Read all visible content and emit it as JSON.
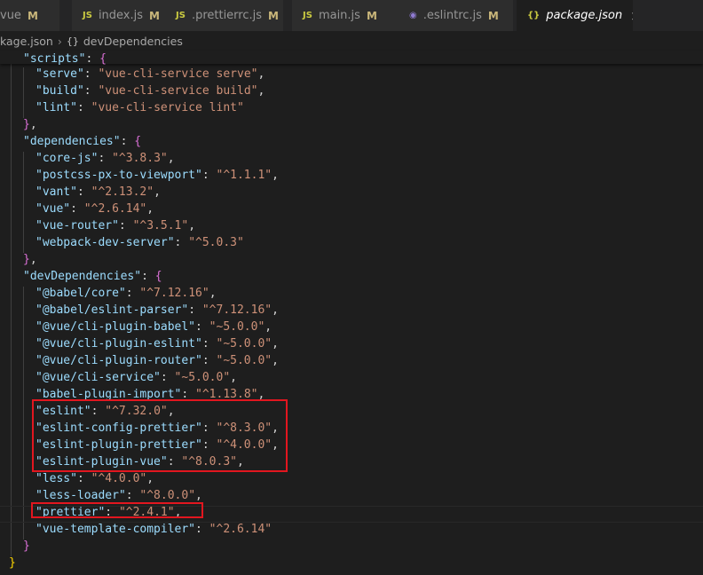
{
  "tabs": [
    {
      "name": "vue",
      "icon": "vue-icon",
      "label": "vue",
      "mod": "M"
    },
    {
      "name": "index-js",
      "icon": "js-icon",
      "icon_text": "JS",
      "label": "index.js",
      "mod": "M"
    },
    {
      "name": "prettierrc-js",
      "icon": "js-icon",
      "icon_text": "JS",
      "label": ".prettierrc.js",
      "mod": "M"
    },
    {
      "name": "main-js",
      "icon": "js-icon",
      "icon_text": "JS",
      "label": "main.js",
      "mod": "M"
    },
    {
      "name": "eslintrc-js",
      "icon": "eslint-icon",
      "icon_text": "◉",
      "label": ".eslintrc.js",
      "mod": "M"
    },
    {
      "name": "package-json",
      "icon": "braces-icon",
      "icon_text": "{}",
      "label": "package.json",
      "close": "×"
    }
  ],
  "breadcrumb": {
    "file": "kage.json",
    "separator": "›",
    "symbol_icon": "{}",
    "symbol": "devDependencies"
  },
  "code": {
    "lines": [
      [
        [
          "k",
          "\"scripts\""
        ],
        [
          "p",
          ": "
        ],
        [
          "b2",
          "{"
        ]
      ],
      [
        [
          "k",
          "\"serve\""
        ],
        [
          "p",
          ": "
        ],
        [
          "s",
          "\"vue-cli-service serve\""
        ],
        [
          "p",
          ","
        ]
      ],
      [
        [
          "k",
          "\"build\""
        ],
        [
          "p",
          ": "
        ],
        [
          "s",
          "\"vue-cli-service build\""
        ],
        [
          "p",
          ","
        ]
      ],
      [
        [
          "k",
          "\"lint\""
        ],
        [
          "p",
          ": "
        ],
        [
          "s",
          "\"vue-cli-service lint\""
        ]
      ],
      [
        [
          "b2",
          "}"
        ],
        [
          "p",
          ","
        ]
      ],
      [
        [
          "k",
          "\"dependencies\""
        ],
        [
          "p",
          ": "
        ],
        [
          "b2",
          "{"
        ]
      ],
      [
        [
          "k",
          "\"core-js\""
        ],
        [
          "p",
          ": "
        ],
        [
          "s",
          "\"^3.8.3\""
        ],
        [
          "p",
          ","
        ]
      ],
      [
        [
          "k",
          "\"postcss-px-to-viewport\""
        ],
        [
          "p",
          ": "
        ],
        [
          "s",
          "\"^1.1.1\""
        ],
        [
          "p",
          ","
        ]
      ],
      [
        [
          "k",
          "\"vant\""
        ],
        [
          "p",
          ": "
        ],
        [
          "s",
          "\"^2.13.2\""
        ],
        [
          "p",
          ","
        ]
      ],
      [
        [
          "k",
          "\"vue\""
        ],
        [
          "p",
          ": "
        ],
        [
          "s",
          "\"^2.6.14\""
        ],
        [
          "p",
          ","
        ]
      ],
      [
        [
          "k",
          "\"vue-router\""
        ],
        [
          "p",
          ": "
        ],
        [
          "s",
          "\"^3.5.1\""
        ],
        [
          "p",
          ","
        ]
      ],
      [
        [
          "k",
          "\"webpack-dev-server\""
        ],
        [
          "p",
          ": "
        ],
        [
          "s",
          "\"^5.0.3\""
        ]
      ],
      [
        [
          "b2",
          "}"
        ],
        [
          "p",
          ","
        ]
      ],
      [
        [
          "k",
          "\"devDependencies\""
        ],
        [
          "p",
          ": "
        ],
        [
          "b2",
          "{"
        ]
      ],
      [
        [
          "k",
          "\"@babel/core\""
        ],
        [
          "p",
          ": "
        ],
        [
          "s",
          "\"^7.12.16\""
        ],
        [
          "p",
          ","
        ]
      ],
      [
        [
          "k",
          "\"@babel/eslint-parser\""
        ],
        [
          "p",
          ": "
        ],
        [
          "s",
          "\"^7.12.16\""
        ],
        [
          "p",
          ","
        ]
      ],
      [
        [
          "k",
          "\"@vue/cli-plugin-babel\""
        ],
        [
          "p",
          ": "
        ],
        [
          "s",
          "\"~5.0.0\""
        ],
        [
          "p",
          ","
        ]
      ],
      [
        [
          "k",
          "\"@vue/cli-plugin-eslint\""
        ],
        [
          "p",
          ": "
        ],
        [
          "s",
          "\"~5.0.0\""
        ],
        [
          "p",
          ","
        ]
      ],
      [
        [
          "k",
          "\"@vue/cli-plugin-router\""
        ],
        [
          "p",
          ": "
        ],
        [
          "s",
          "\"~5.0.0\""
        ],
        [
          "p",
          ","
        ]
      ],
      [
        [
          "k",
          "\"@vue/cli-service\""
        ],
        [
          "p",
          ": "
        ],
        [
          "s",
          "\"~5.0.0\""
        ],
        [
          "p",
          ","
        ]
      ],
      [
        [
          "k",
          "\"babel-plugin-import\""
        ],
        [
          "p",
          ": "
        ],
        [
          "s",
          "\"^1.13.8\""
        ],
        [
          "p",
          ","
        ]
      ],
      [
        [
          "k",
          "\"eslint\""
        ],
        [
          "p",
          ": "
        ],
        [
          "s",
          "\"^7.32.0\""
        ],
        [
          "p",
          ","
        ]
      ],
      [
        [
          "k",
          "\"eslint-config-prettier\""
        ],
        [
          "p",
          ": "
        ],
        [
          "s",
          "\"^8.3.0\""
        ],
        [
          "p",
          ","
        ]
      ],
      [
        [
          "k",
          "\"eslint-plugin-prettier\""
        ],
        [
          "p",
          ": "
        ],
        [
          "s",
          "\"^4.0.0\""
        ],
        [
          "p",
          ","
        ]
      ],
      [
        [
          "k",
          "\"eslint-plugin-vue\""
        ],
        [
          "p",
          ": "
        ],
        [
          "s",
          "\"^8.0.3\""
        ],
        [
          "p",
          ","
        ]
      ],
      [
        [
          "k",
          "\"less\""
        ],
        [
          "p",
          ": "
        ],
        [
          "s",
          "\"^4.0.0\""
        ],
        [
          "p",
          ","
        ]
      ],
      [
        [
          "k",
          "\"less-loader\""
        ],
        [
          "p",
          ": "
        ],
        [
          "s",
          "\"^8.0.0\""
        ],
        [
          "p",
          ","
        ]
      ],
      [
        [
          "k",
          "\"prettier\""
        ],
        [
          "p",
          ": "
        ],
        [
          "s",
          "\"^2.4.1\""
        ],
        [
          "p",
          ","
        ]
      ],
      [
        [
          "k",
          "\"vue-template-compiler\""
        ],
        [
          "p",
          ": "
        ],
        [
          "s",
          "\"^2.6.14\""
        ]
      ],
      [
        [
          "b2",
          "}"
        ]
      ],
      [
        [
          "b1",
          "}"
        ]
      ]
    ]
  },
  "colors": {
    "highlight_box": "#e2161f",
    "key": "#9cdcfe",
    "string": "#ce9178",
    "bracket_outer": "#ffd700",
    "bracket_inner": "#da70d6"
  }
}
